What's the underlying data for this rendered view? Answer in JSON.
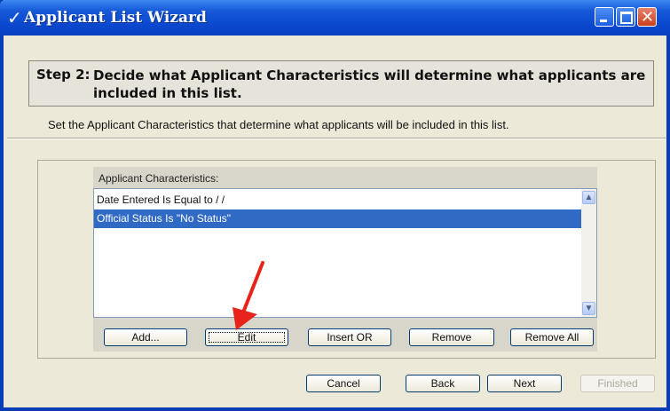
{
  "window": {
    "title": "Applicant List Wizard",
    "title_check": "✓"
  },
  "step": {
    "label": "Step 2:",
    "text": "Decide what Applicant Characteristics will determine what applicants are included in this list."
  },
  "instruction": "Set the Applicant Characteristics that determine what applicants will be included in this list.",
  "characteristics": {
    "header": "Applicant Characteristics:",
    "items": [
      {
        "label": "Date Entered Is Equal to / /",
        "selected": false
      },
      {
        "label": "Official Status Is \"No Status\"",
        "selected": true
      }
    ]
  },
  "list_buttons": {
    "add": "Add...",
    "edit": "Edit",
    "insert_or": "Insert OR",
    "remove": "Remove",
    "remove_all": "Remove All"
  },
  "footer_buttons": {
    "cancel": "Cancel",
    "back": "Back",
    "next": "Next",
    "finished": "Finished"
  },
  "colors": {
    "titlebar": "#0b48cf",
    "selection": "#316ac5",
    "annotation_arrow": "#e8231b"
  }
}
